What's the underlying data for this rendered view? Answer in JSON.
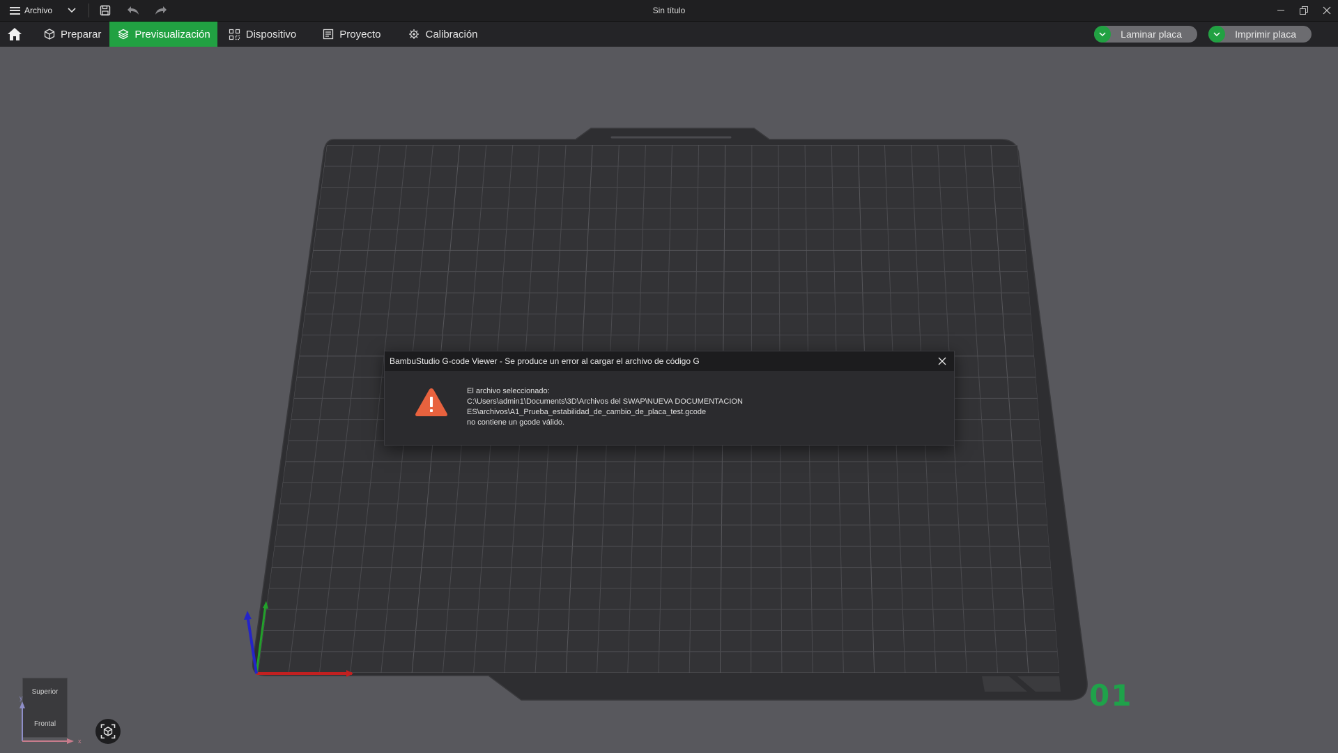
{
  "titlebar": {
    "menu_label": "Archivo",
    "window_title": "Sin título"
  },
  "tabs": [
    {
      "label": "Preparar",
      "icon": "cube-icon"
    },
    {
      "label": "Previsualización",
      "icon": "layers-icon"
    },
    {
      "label": "Dispositivo",
      "icon": "device-icon"
    },
    {
      "label": "Proyecto",
      "icon": "project-icon"
    },
    {
      "label": "Calibración",
      "icon": "calibration-icon"
    }
  ],
  "active_tab": "Previsualización",
  "actions": {
    "slice_label": "Laminar placa",
    "print_label": "Imprimir placa"
  },
  "viewport": {
    "plate_number": "01",
    "view_cube_top": "Superior",
    "view_cube_front": "Frontal",
    "axis_y": "y",
    "axis_x": "x"
  },
  "dialog": {
    "title": "BambuStudio G-code Viewer - Se produce un error al cargar el archivo de código G",
    "line1": "El archivo seleccionado:",
    "line2": "C:\\Users\\admin1\\Documents\\3D\\Archivos del SWAP\\NUEVA DOCUMENTACION",
    "line3": "ES\\archivos\\A1_Prueba_estabilidad_de_cambio_de_placa_test.gcode",
    "line4": "no contiene un gcode válido."
  },
  "colors": {
    "accent": "#21a142",
    "warning": "#e8623e",
    "background": "#58585d"
  }
}
